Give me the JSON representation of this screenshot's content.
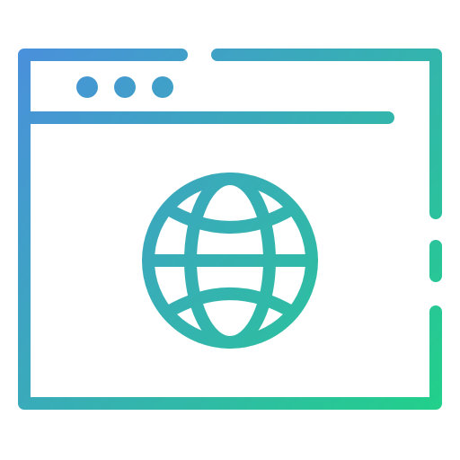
{
  "icon": {
    "name": "browser-globe-icon",
    "gradient": {
      "start_color": "#4a90dc",
      "end_color": "#22d08a"
    }
  }
}
